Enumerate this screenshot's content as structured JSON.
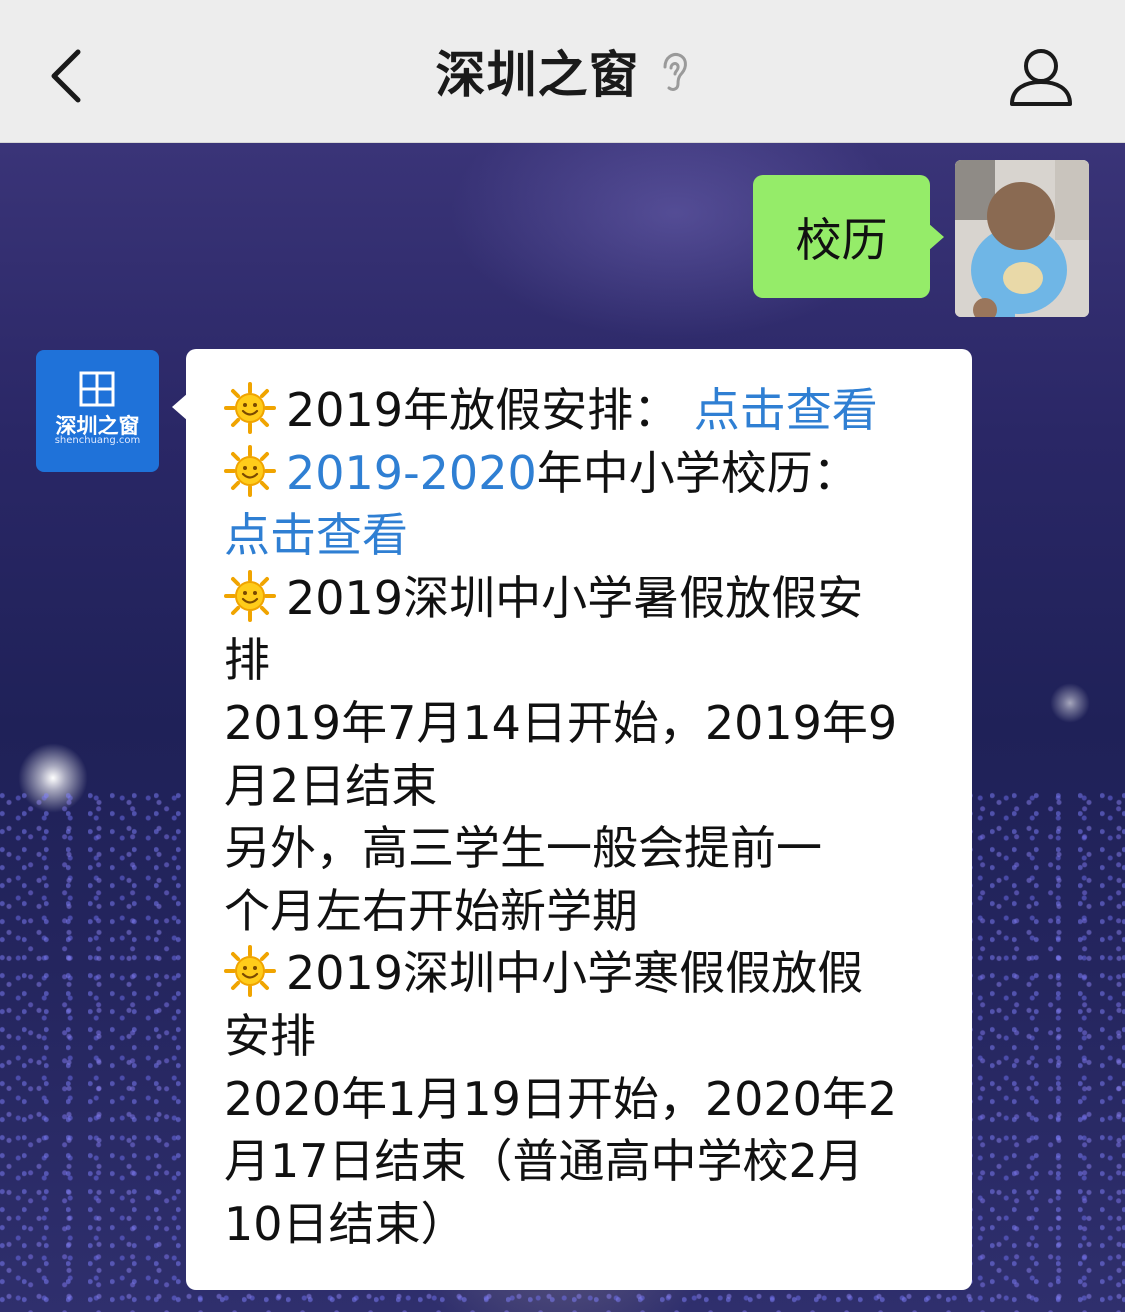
{
  "navbar": {
    "title": "深圳之窗",
    "back_icon": "chevron-left-icon",
    "ear_icon": "ear-icon",
    "profile_icon": "person-icon"
  },
  "outgoing": {
    "text": "校历"
  },
  "account": {
    "logo_text": "深圳之窗",
    "logo_sub": "shenchuang.com"
  },
  "message": {
    "l1_text": "2019年放假安排：",
    "l1_link": "点击查看",
    "l2_link": "2019-2020",
    "l2_text": "年中小学校历：",
    "l3_link": "点击查看",
    "l4_text": "2019深圳中小学暑假放假安",
    "l5_text": "排",
    "l6_text": "2019年7月14日开始，2019年9",
    "l7_text": "月2日结束",
    "l8_text": "另外，高三学生一般会提前一",
    "l9_text": "个月左右开始新学期",
    "l10_text": "2019深圳中小学寒假假放假",
    "l11_text": "安排",
    "l12_text": "2020年1月19日开始，2020年2",
    "l13_text": "月17日结束（普通高中学校2月",
    "l14_text": "10日结束）"
  },
  "colors": {
    "outgoing_bubble": "#95ec69",
    "link": "#2f7fd3",
    "navbar_bg": "#ededed"
  }
}
